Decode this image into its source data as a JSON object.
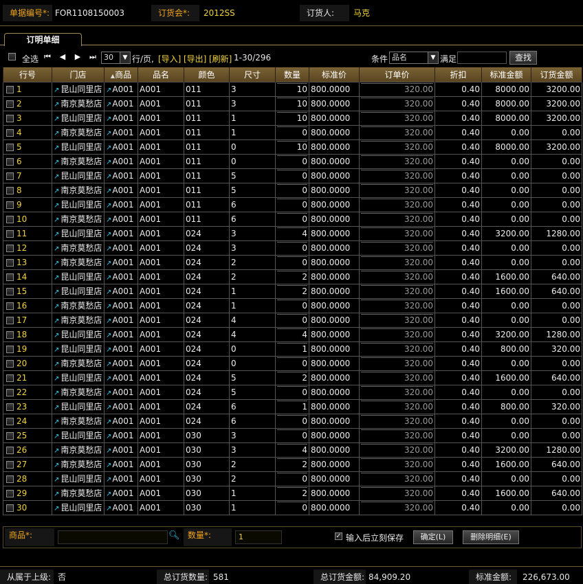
{
  "header": {
    "doc_no_label": "单据编号*:",
    "doc_no_value": "FOR1108150003",
    "fair_label": "订货会*:",
    "fair_value": "2012SS",
    "buyer_label": "订货人:",
    "buyer_value": "马克"
  },
  "tab": {
    "label": "订明单细"
  },
  "toolbar": {
    "select_all": "全选",
    "page_size": "30",
    "per_page_text": "行/页,",
    "import": "[导入]",
    "export": "[导出]",
    "refresh": "[刷新]",
    "range": "1-30/296",
    "condition_label": "条件",
    "condition_field": "品名",
    "satisfy_label": "满足",
    "search_button": "查找"
  },
  "columns": [
    "行号",
    "门店",
    "商品",
    "品名",
    "颜色",
    "尺寸",
    "数量",
    "标准价",
    "订单价",
    "折扣",
    "标准金额",
    "订货金额"
  ],
  "sort_indicator": "▲",
  "rows": [
    [
      "1",
      "昆山同里店",
      "A001",
      "A001",
      "011",
      "3",
      "10",
      "800.0000",
      "320.00",
      "0.40",
      "8000.00",
      "3200.00"
    ],
    [
      "2",
      "南京莫愁店",
      "A001",
      "A001",
      "011",
      "3",
      "10",
      "800.0000",
      "320.00",
      "0.40",
      "8000.00",
      "3200.00"
    ],
    [
      "3",
      "昆山同里店",
      "A001",
      "A001",
      "011",
      "1",
      "10",
      "800.0000",
      "320.00",
      "0.40",
      "8000.00",
      "3200.00"
    ],
    [
      "4",
      "南京莫愁店",
      "A001",
      "A001",
      "011",
      "1",
      "0",
      "800.0000",
      "320.00",
      "0.40",
      "0.00",
      "0.00"
    ],
    [
      "5",
      "昆山同里店",
      "A001",
      "A001",
      "011",
      "0",
      "10",
      "800.0000",
      "320.00",
      "0.40",
      "8000.00",
      "3200.00"
    ],
    [
      "6",
      "南京莫愁店",
      "A001",
      "A001",
      "011",
      "0",
      "0",
      "800.0000",
      "320.00",
      "0.40",
      "0.00",
      "0.00"
    ],
    [
      "7",
      "昆山同里店",
      "A001",
      "A001",
      "011",
      "5",
      "0",
      "800.0000",
      "320.00",
      "0.40",
      "0.00",
      "0.00"
    ],
    [
      "8",
      "南京莫愁店",
      "A001",
      "A001",
      "011",
      "5",
      "0",
      "800.0000",
      "320.00",
      "0.40",
      "0.00",
      "0.00"
    ],
    [
      "9",
      "昆山同里店",
      "A001",
      "A001",
      "011",
      "6",
      "0",
      "800.0000",
      "320.00",
      "0.40",
      "0.00",
      "0.00"
    ],
    [
      "10",
      "南京莫愁店",
      "A001",
      "A001",
      "011",
      "6",
      "0",
      "800.0000",
      "320.00",
      "0.40",
      "0.00",
      "0.00"
    ],
    [
      "11",
      "昆山同里店",
      "A001",
      "A001",
      "024",
      "3",
      "4",
      "800.0000",
      "320.00",
      "0.40",
      "3200.00",
      "1280.00"
    ],
    [
      "12",
      "南京莫愁店",
      "A001",
      "A001",
      "024",
      "3",
      "0",
      "800.0000",
      "320.00",
      "0.40",
      "0.00",
      "0.00"
    ],
    [
      "13",
      "南京莫愁店",
      "A001",
      "A001",
      "024",
      "2",
      "0",
      "800.0000",
      "320.00",
      "0.40",
      "0.00",
      "0.00"
    ],
    [
      "14",
      "昆山同里店",
      "A001",
      "A001",
      "024",
      "2",
      "2",
      "800.0000",
      "320.00",
      "0.40",
      "1600.00",
      "640.00"
    ],
    [
      "15",
      "昆山同里店",
      "A001",
      "A001",
      "024",
      "1",
      "2",
      "800.0000",
      "320.00",
      "0.40",
      "1600.00",
      "640.00"
    ],
    [
      "16",
      "南京莫愁店",
      "A001",
      "A001",
      "024",
      "1",
      "0",
      "800.0000",
      "320.00",
      "0.40",
      "0.00",
      "0.00"
    ],
    [
      "17",
      "南京莫愁店",
      "A001",
      "A001",
      "024",
      "4",
      "0",
      "800.0000",
      "320.00",
      "0.40",
      "0.00",
      "0.00"
    ],
    [
      "18",
      "昆山同里店",
      "A001",
      "A001",
      "024",
      "4",
      "4",
      "800.0000",
      "320.00",
      "0.40",
      "3200.00",
      "1280.00"
    ],
    [
      "19",
      "昆山同里店",
      "A001",
      "A001",
      "024",
      "0",
      "1",
      "800.0000",
      "320.00",
      "0.40",
      "800.00",
      "320.00"
    ],
    [
      "20",
      "南京莫愁店",
      "A001",
      "A001",
      "024",
      "0",
      "0",
      "800.0000",
      "320.00",
      "0.40",
      "0.00",
      "0.00"
    ],
    [
      "21",
      "昆山同里店",
      "A001",
      "A001",
      "024",
      "5",
      "2",
      "800.0000",
      "320.00",
      "0.40",
      "1600.00",
      "640.00"
    ],
    [
      "22",
      "南京莫愁店",
      "A001",
      "A001",
      "024",
      "5",
      "0",
      "800.0000",
      "320.00",
      "0.40",
      "0.00",
      "0.00"
    ],
    [
      "23",
      "昆山同里店",
      "A001",
      "A001",
      "024",
      "6",
      "1",
      "800.0000",
      "320.00",
      "0.40",
      "800.00",
      "320.00"
    ],
    [
      "24",
      "南京莫愁店",
      "A001",
      "A001",
      "024",
      "6",
      "0",
      "800.0000",
      "320.00",
      "0.40",
      "0.00",
      "0.00"
    ],
    [
      "25",
      "昆山同里店",
      "A001",
      "A001",
      "030",
      "3",
      "0",
      "800.0000",
      "320.00",
      "0.40",
      "0.00",
      "0.00"
    ],
    [
      "26",
      "南京莫愁店",
      "A001",
      "A001",
      "030",
      "3",
      "4",
      "800.0000",
      "320.00",
      "0.40",
      "3200.00",
      "1280.00"
    ],
    [
      "27",
      "南京莫愁店",
      "A001",
      "A001",
      "030",
      "2",
      "2",
      "800.0000",
      "320.00",
      "0.40",
      "1600.00",
      "640.00"
    ],
    [
      "28",
      "昆山同里店",
      "A001",
      "A001",
      "030",
      "2",
      "0",
      "800.0000",
      "320.00",
      "0.40",
      "0.00",
      "0.00"
    ],
    [
      "29",
      "南京莫愁店",
      "A001",
      "A001",
      "030",
      "1",
      "2",
      "800.0000",
      "320.00",
      "0.40",
      "1600.00",
      "640.00"
    ],
    [
      "30",
      "昆山同里店",
      "A001",
      "A001",
      "030",
      "1",
      "0",
      "800.0000",
      "320.00",
      "0.40",
      "0.00",
      "0.00"
    ]
  ],
  "entry": {
    "product_label": "商品*:",
    "product_value": "",
    "qty_label": "数量*:",
    "qty_value": "1",
    "save_after_input_label": "输入后立刻保存",
    "save_after_input_checked": true,
    "confirm_button": "确定(L)",
    "delete_button": "删除明细(E)"
  },
  "footer": {
    "parent_label": "从属于上级:",
    "parent_value": "否",
    "total_qty_label": "总订货数量:",
    "total_qty_value": "581",
    "total_amount_label": "总订货金额:",
    "total_amount_value": "84,909.20",
    "std_amount_label": "标准金额:",
    "std_amount_value": "226,673.00"
  },
  "colors": {
    "label_orange": "#f2a51a",
    "value_yellow": "#f0d23c",
    "header_bar": "#6e5426",
    "icon_cyan": "#2ec8f0"
  }
}
